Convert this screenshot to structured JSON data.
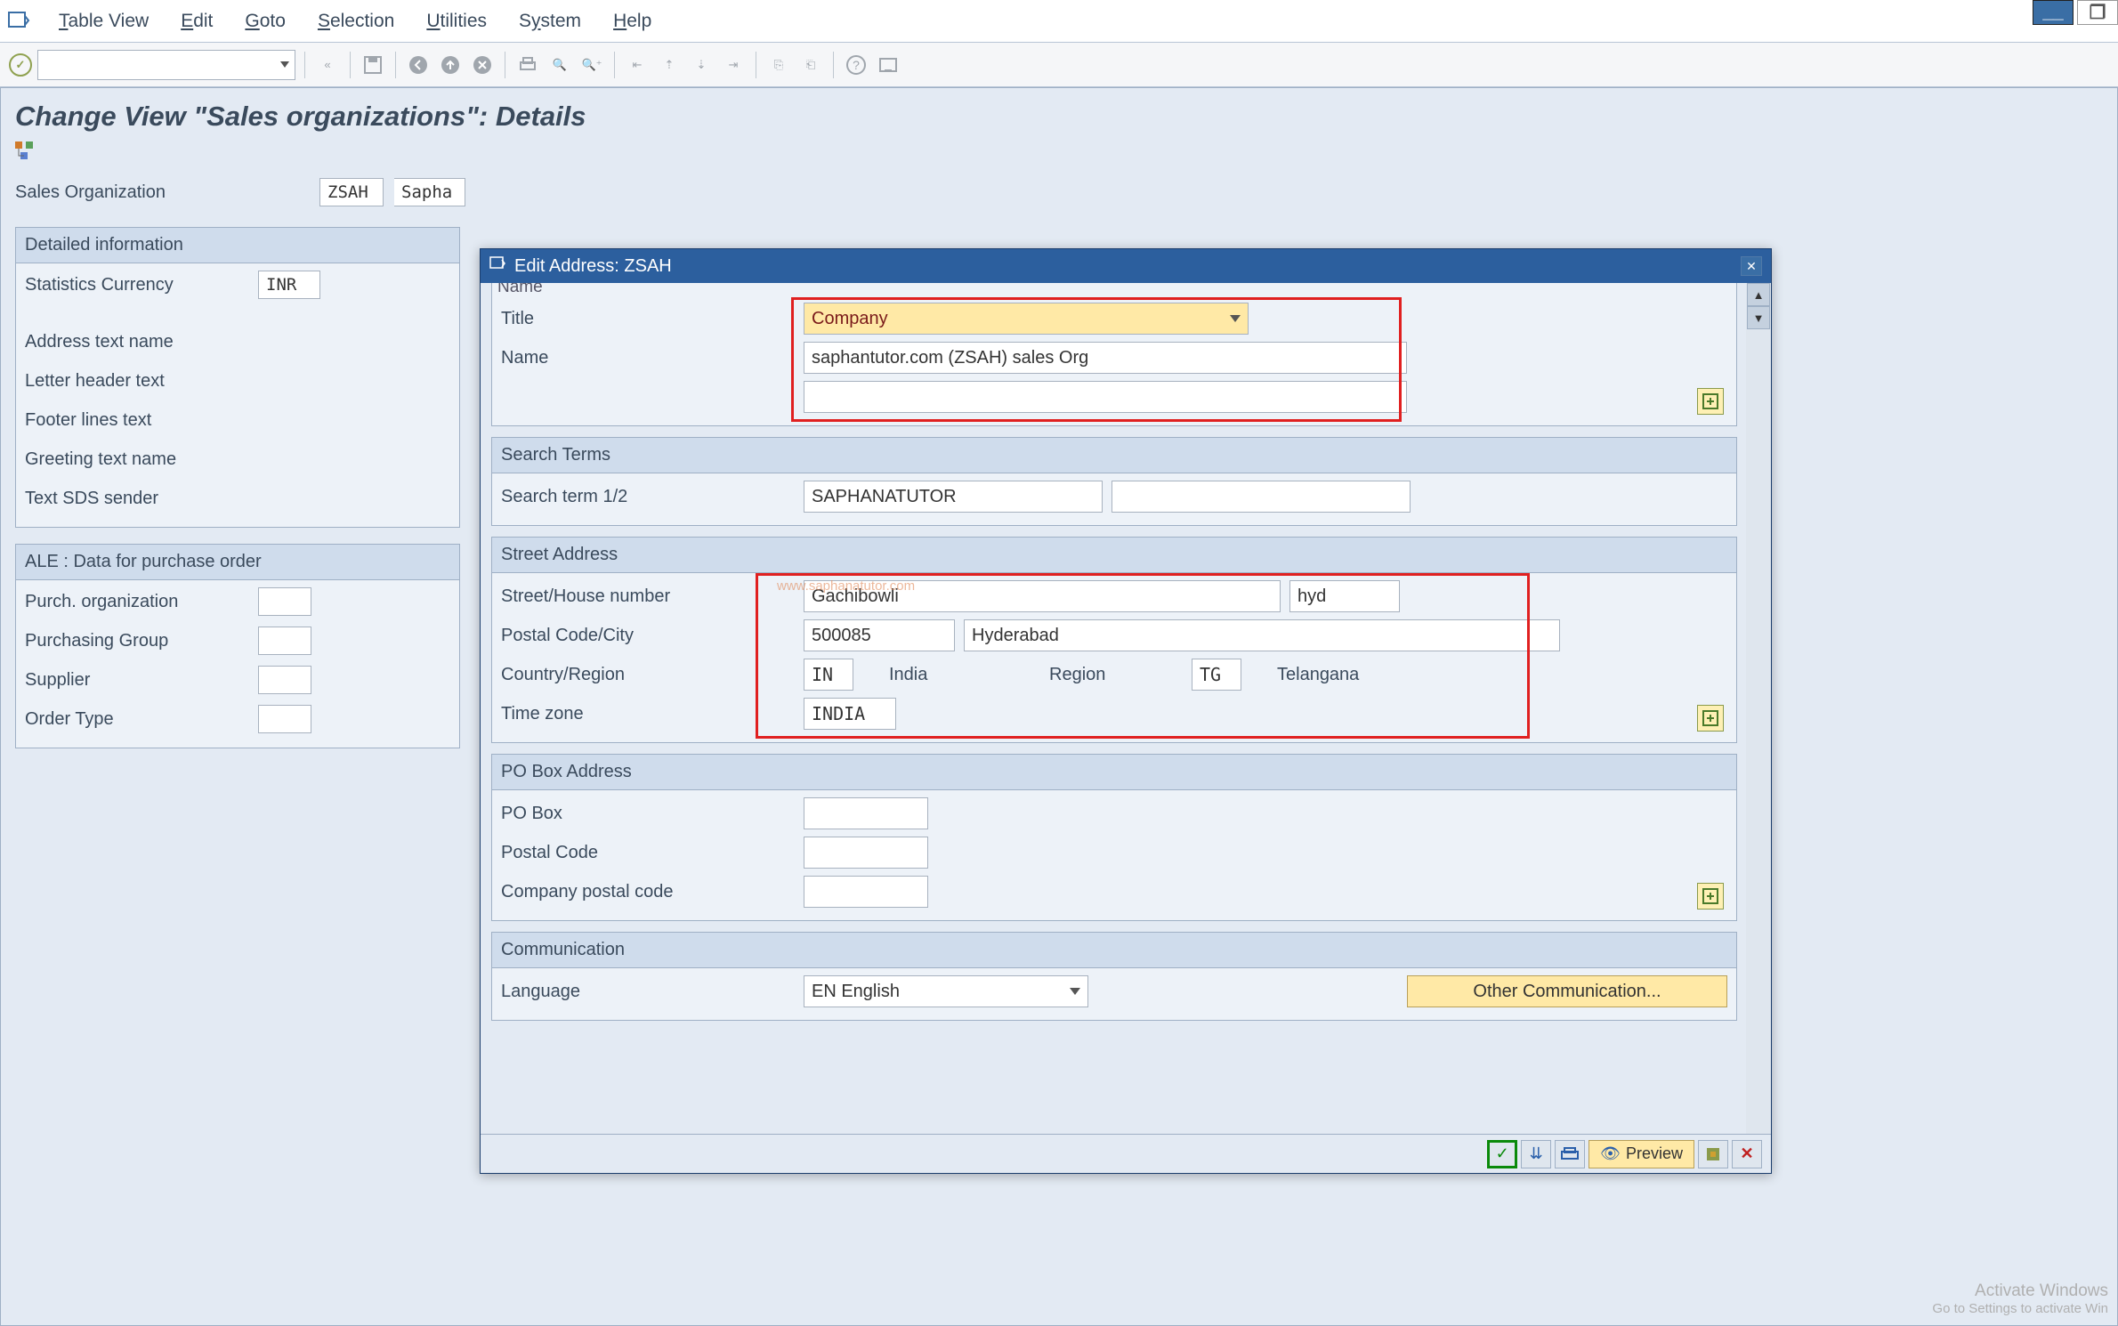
{
  "menu": {
    "items": [
      "Table View",
      "Edit",
      "Goto",
      "Selection",
      "Utilities",
      "System",
      "Help"
    ]
  },
  "page": {
    "title": "Change View \"Sales organizations\": Details"
  },
  "sales_org": {
    "label": "Sales Organization",
    "code": "ZSAH",
    "name": "Sapha"
  },
  "detailed": {
    "header": "Detailed information",
    "stats_currency_label": "Statistics Currency",
    "stats_currency": "INR",
    "address_text_label": "Address text name",
    "letter_header_label": "Letter header text",
    "footer_lines_label": "Footer lines text",
    "greeting_text_label": "Greeting text name",
    "text_sds_label": "Text SDS sender"
  },
  "ale": {
    "header": "ALE : Data for purchase order",
    "purch_org_label": "Purch. organization",
    "purch_group_label": "Purchasing Group",
    "supplier_label": "Supplier",
    "order_type_label": "Order Type"
  },
  "dialog": {
    "title": "Edit Address:  ZSAH",
    "name_section": {
      "title_label": "Title",
      "title_value": "Company",
      "name_label": "Name",
      "name_value": "saphantutor.com (ZSAH) sales Org"
    },
    "search": {
      "header": "Search Terms",
      "label": "Search term 1/2",
      "value": "SAPHANATUTOR"
    },
    "street": {
      "header": "Street Address",
      "street_label": "Street/House number",
      "street_value": "Gachibowli",
      "house_value": "hyd",
      "postal_label": "Postal Code/City",
      "postal_value": "500085",
      "city_value": "Hyderabad",
      "country_label": "Country/Region",
      "country_code": "IN",
      "country_name": "India",
      "region_label": "Region",
      "region_code": "TG",
      "region_name": "Telangana",
      "timezone_label": "Time zone",
      "timezone_value": "INDIA"
    },
    "pobox": {
      "header": "PO Box Address",
      "pobox_label": "PO Box",
      "postal_label": "Postal Code",
      "company_postal_label": "Company postal code"
    },
    "comm": {
      "header": "Communication",
      "language_label": "Language",
      "language_value": "EN English",
      "other_label": "Other Communication..."
    },
    "footer": {
      "preview_label": "Preview"
    }
  },
  "watermark": "www.saphanatutor.com",
  "activate": {
    "line1": "Activate Windows",
    "line2": "Go to Settings to activate Win"
  }
}
